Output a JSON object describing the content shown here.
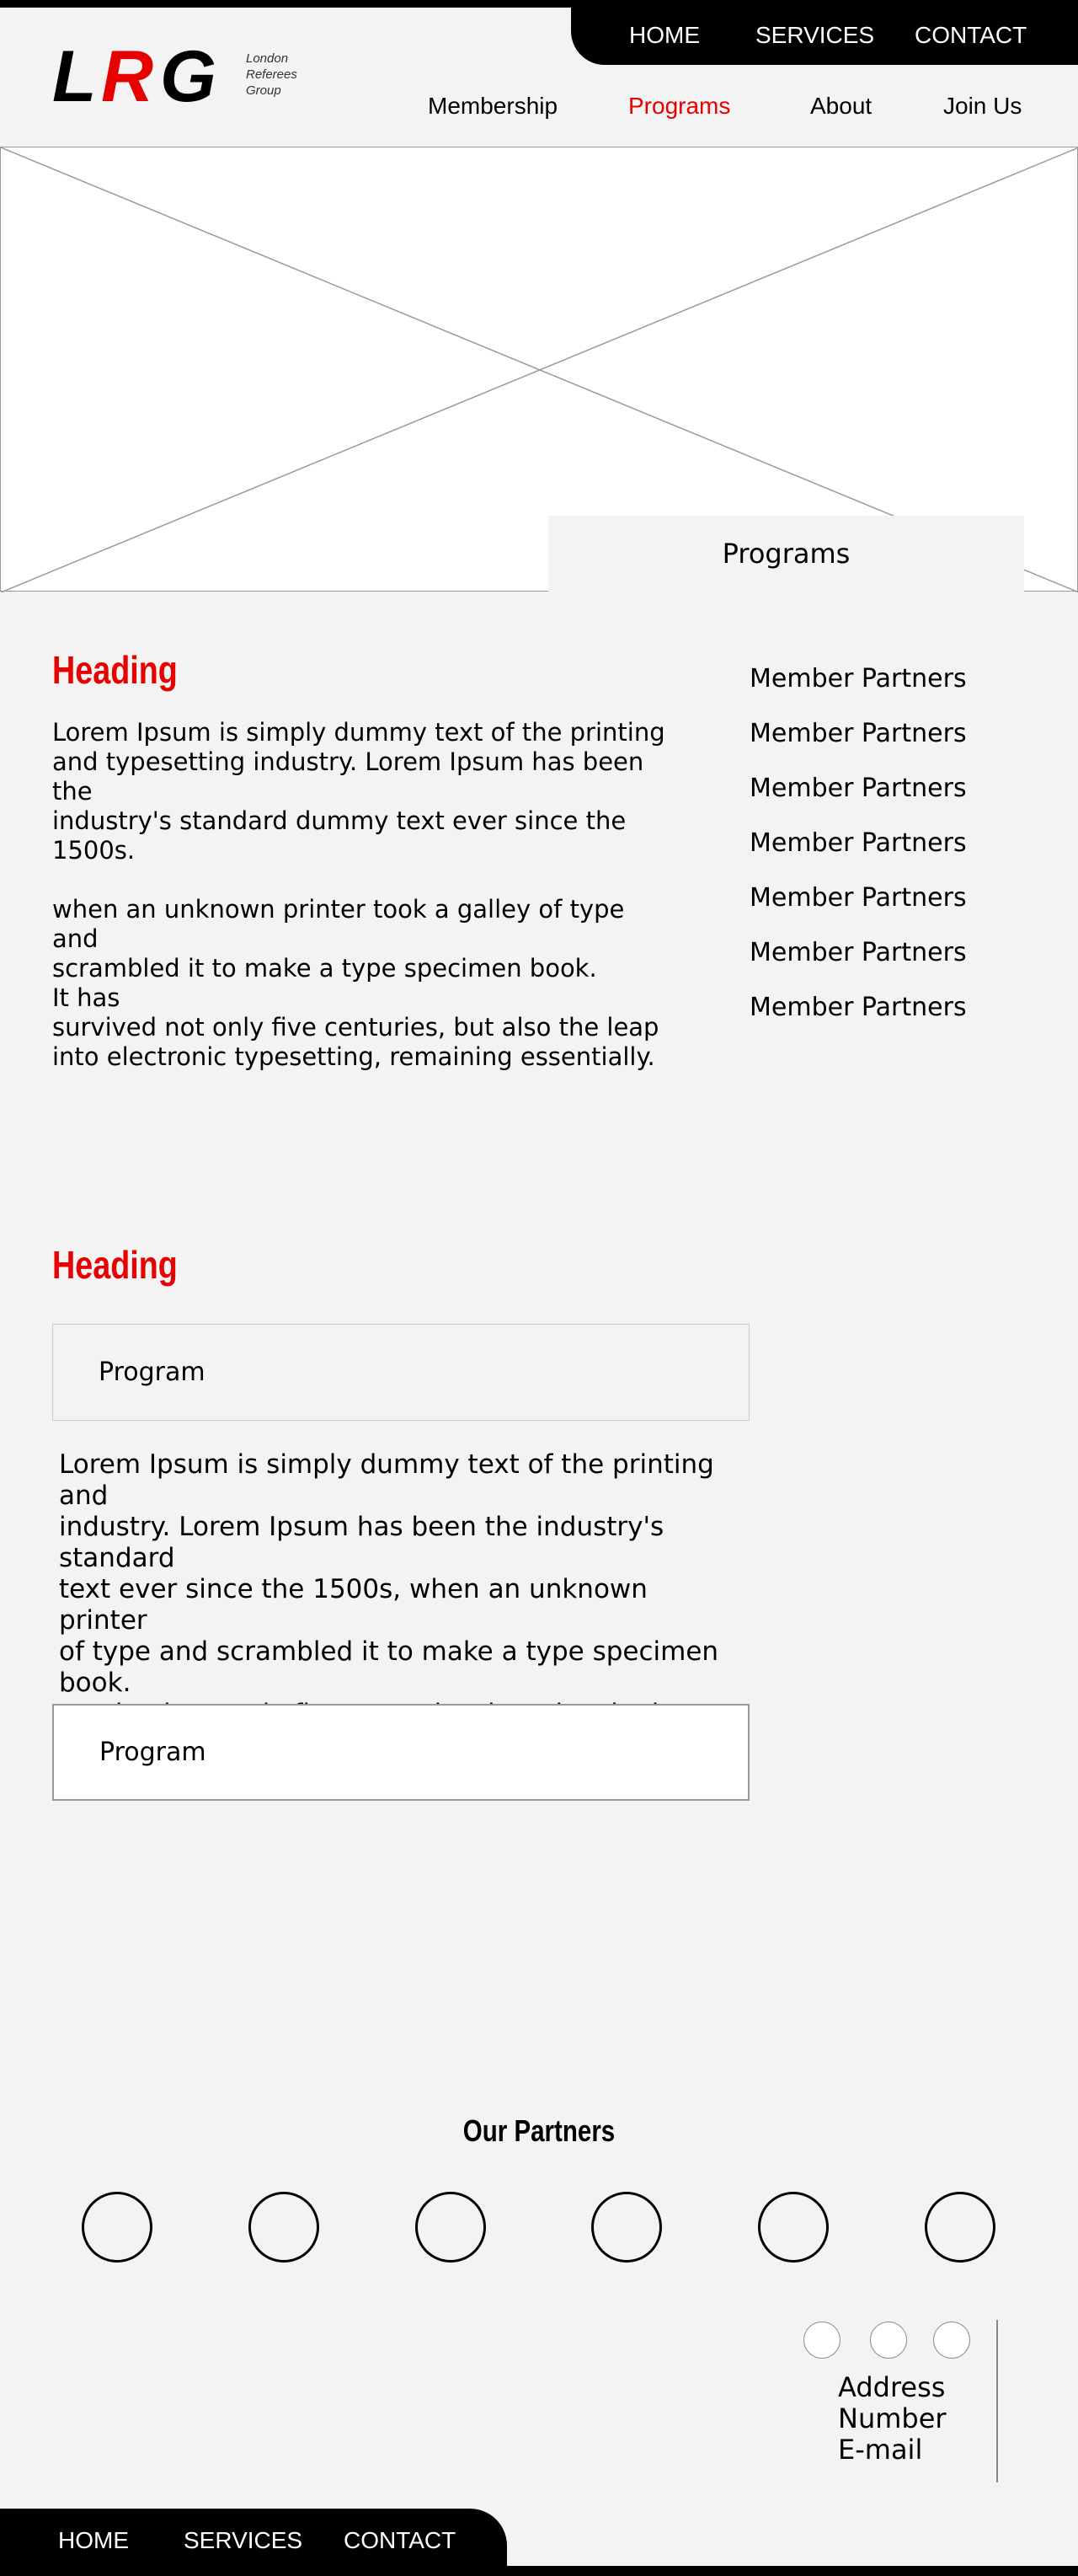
{
  "header": {
    "top_nav": [
      "HOME",
      "SERVICES",
      "CONTACT"
    ],
    "logo_text": "LRG",
    "logo_sub": [
      "London",
      "Referees",
      "Group"
    ],
    "sub_nav": [
      "Membership",
      "Programs",
      "About",
      "Join Us"
    ],
    "active_sub_nav": "Programs",
    "accent_color": "#e60000"
  },
  "hero": {
    "tab_label": "Programs"
  },
  "sidebar": {
    "items": [
      "Member Partners",
      "Member Partners",
      "Member Partners",
      "Member Partners",
      "Member Partners",
      "Member Partners",
      "Member Partners"
    ]
  },
  "section1": {
    "heading": "Heading",
    "body": "Lorem Ipsum is simply dummy text of the printing\nand typesetting industry. Lorem Ipsum has been the\nindustry's standard dummy text ever since the 1500s.\n\nwhen an unknown printer took a galley of type and\nscrambled it to make a type specimen book.\nIt has\nsurvived not only five centuries, but also the leap\ninto electronic typesetting, remaining essentially."
  },
  "section2": {
    "heading": "Heading",
    "programs": [
      {
        "title": "Program",
        "expanded": true
      },
      {
        "title": "Program",
        "expanded": false
      }
    ],
    "expanded_body": "Lorem Ipsum is simply dummy text of the printing and\nindustry. Lorem Ipsum has been the industry's standard\ntext ever since the 1500s, when an unknown printer\nof type and scrambled it to make a type specimen book.\nsurvived not only five centuries, but also the leap into\ntypesetting, remaining essentially unchanged."
  },
  "partners": {
    "title": "Our Partners",
    "logo_count": 6
  },
  "contact": {
    "lines": [
      "Address",
      "Number",
      "E-mail"
    ],
    "social_icons": [
      "social-icon",
      "social-icon",
      "social-icon"
    ]
  },
  "footer": {
    "nav": [
      "HOME",
      "SERVICES",
      "CONTACT"
    ]
  }
}
